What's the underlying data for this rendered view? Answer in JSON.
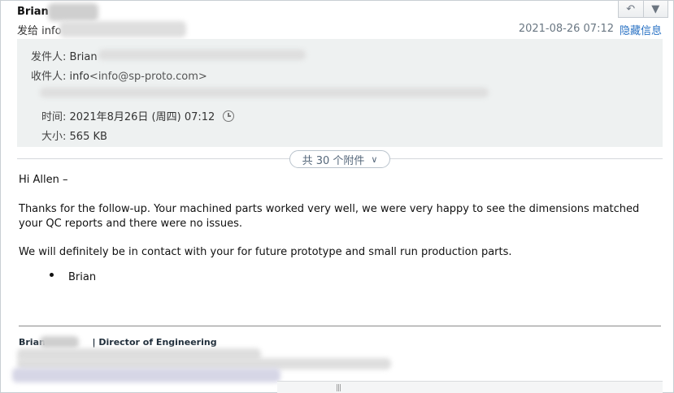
{
  "header": {
    "sender_name": "Brian",
    "to_prefix": "发给",
    "to_name": "info",
    "date": "2021-08-26 07:12",
    "hide_info_label": "隐藏信息"
  },
  "details": {
    "from_label": "发件人:",
    "from_name": "Brian",
    "to_label": "收件人:",
    "to_name": "info",
    "to_address": "<info@sp-proto.com>",
    "time_label": "时间:",
    "time_value": "2021年8月26日 (周四) 07:12",
    "size_label": "大小:",
    "size_value": "565 KB"
  },
  "attachments": {
    "label": "共 30 个附件"
  },
  "body": {
    "greeting": "Hi Allen –",
    "paragraph1": "Thanks for the follow-up.  Your machined parts worked very well, we were very happy to see the dimensions matched your QC reports and there were no issues.",
    "paragraph2": "We will definitely be in contact with your for future prototype and small run production parts.",
    "bullet": "Brian"
  },
  "signature": {
    "name": "Brian",
    "title": "| Director of Engineering"
  },
  "colors": {
    "link": "#2a72c4",
    "details_bg": "#eef1f1",
    "date_gray": "#6a7783"
  }
}
